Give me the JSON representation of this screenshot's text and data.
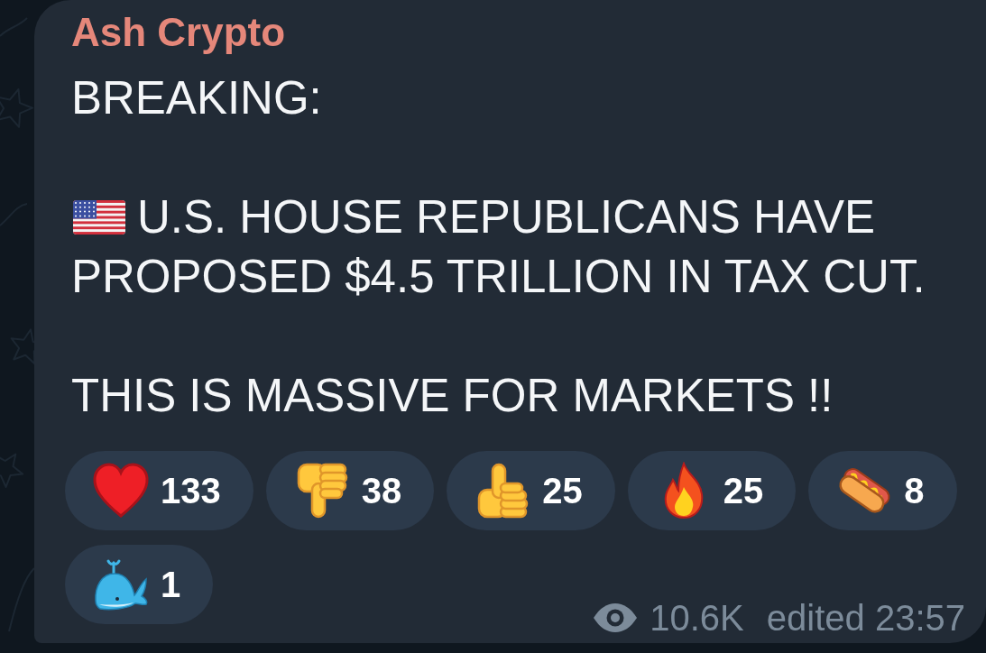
{
  "message": {
    "sender": "Ash Crypto",
    "headline": "BREAKING:",
    "body_lines": [
      "U.S. HOUSE REPUBLICANS HAVE",
      "PROPOSED $4.5 TRILLION IN TAX CUT."
    ],
    "closing": "THIS IS MASSIVE FOR MARKETS !!"
  },
  "reactions": [
    {
      "kind": "heart",
      "count": "133",
      "selected": false
    },
    {
      "kind": "dislike",
      "count": "38",
      "selected": false
    },
    {
      "kind": "like",
      "count": "25",
      "selected": false
    },
    {
      "kind": "fire",
      "count": "25",
      "selected": false
    },
    {
      "kind": "hotdog",
      "count": "8",
      "selected": false
    },
    {
      "kind": "whale",
      "count": "1",
      "selected": false
    }
  ],
  "footer": {
    "views": "10.6K",
    "edited": "edited 23:57"
  }
}
